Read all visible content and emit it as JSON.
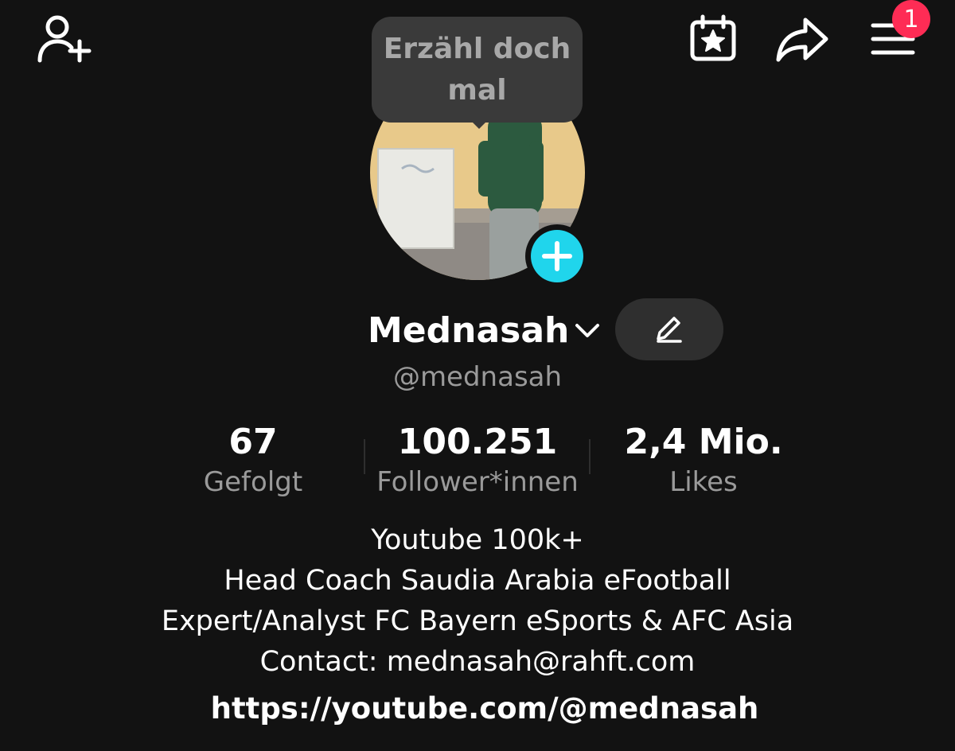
{
  "header": {
    "add_friend_icon": "person-plus-icon",
    "calendar_icon": "calendar-star-icon",
    "share_icon": "share-arrow-icon",
    "menu_icon": "hamburger-menu-icon",
    "menu_badge": "1"
  },
  "tooltip": {
    "text": "Erzähl doch mal"
  },
  "profile": {
    "name": "Mednasah",
    "handle": "@mednasah"
  },
  "stats": [
    {
      "value": "67",
      "label": "Gefolgt"
    },
    {
      "value": "100.251",
      "label": "Follower*innen"
    },
    {
      "value": "2,4 Mio.",
      "label": "Likes"
    }
  ],
  "bio": {
    "lines": [
      "Youtube 100k+",
      "Head Coach Saudia Arabia eFootball",
      "Expert/Analyst FC Bayern eSports & AFC Asia",
      "Contact: mednasah@rahft.com"
    ],
    "link": "https://youtube.com/@mednasah"
  },
  "colors": {
    "background": "#121212",
    "badge": "#fe2c55",
    "add_story": "#20d5ec",
    "secondary_text": "#9a9a9a"
  }
}
